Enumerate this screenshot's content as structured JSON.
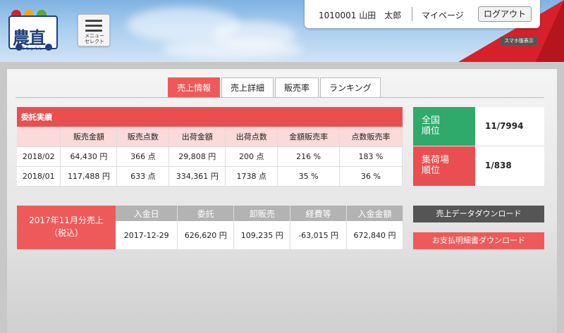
{
  "header": {
    "logo_text": "農直",
    "logo_sub": "ゆうちょくん",
    "menu_label_line1": "メニュー",
    "menu_label_line2": "セレクト",
    "user_id": "1010001",
    "user_name": "山田　太郎",
    "mypage_label": "マイページ",
    "logout_label": "ログアウト",
    "sp_view_label": "スマホ版表示"
  },
  "tabs": [
    {
      "label": "売上情報",
      "active": true
    },
    {
      "label": "売上詳細",
      "active": false
    },
    {
      "label": "販売率",
      "active": false
    },
    {
      "label": "ランキング",
      "active": false
    }
  ],
  "sales": {
    "title": "委託実績",
    "headers": [
      "",
      "販売金額",
      "販売点数",
      "出荷金額",
      "出荷点数",
      "金額販売率",
      "点数販売率"
    ],
    "rows": [
      [
        "2018/02",
        "64,430 円",
        "366 点",
        "29,808 円",
        "200 点",
        "216 %",
        "183 %"
      ],
      [
        "2018/01",
        "117,488 円",
        "633 点",
        "334,361 円",
        "1738 点",
        "35 %",
        "36 %"
      ]
    ]
  },
  "rank": {
    "national_label_1": "全国",
    "national_label_2": "順位",
    "national_value": "11/7994",
    "local_label_1": "集荷場",
    "local_label_2": "順位",
    "local_value": "1/838"
  },
  "payment": {
    "label_line1": "2017年11月分売上",
    "label_line2": "（税込）",
    "headers": [
      "入金日",
      "委託",
      "卸販売",
      "経費等",
      "入金金額"
    ],
    "values": [
      "2017-12-29",
      "626,620 円",
      "109,235 円",
      "-63,015 円",
      "672,840 円"
    ]
  },
  "downloads": {
    "sales_data": "売上データダウンロード",
    "payment_detail": "お支払明細書ダウンロード"
  },
  "colors": {
    "accent_red": "#ee5a5a",
    "title_red": "#e94f50",
    "rank_green": "#2faa6a",
    "header_gray": "#b3b3b3",
    "dark_button": "#555555"
  }
}
